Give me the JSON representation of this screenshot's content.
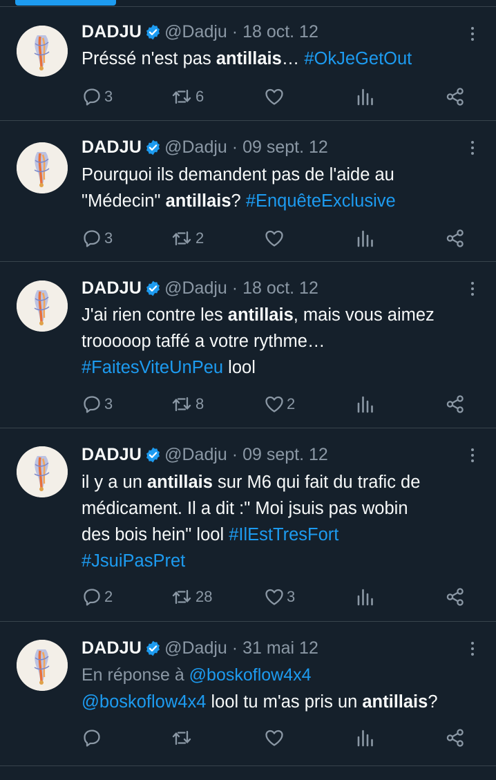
{
  "colors": {
    "background": "#15202b",
    "text": "#f7f9f9",
    "muted": "#8b98a5",
    "accent": "#1d9bf0",
    "divider": "#38444d"
  },
  "icons": {
    "verified": "verified-badge-icon",
    "more": "more-options-icon",
    "reply": "reply-icon",
    "retweet": "retweet-icon",
    "like": "like-icon",
    "views": "views-icon",
    "share": "share-icon"
  },
  "tweets": [
    {
      "name": "DADJU",
      "handle": "@Dadju",
      "separator": "·",
      "date": "18 oct. 12",
      "lines": [
        [
          {
            "t": "Préssé n'est pas "
          },
          {
            "t": "antillais",
            "s": "b"
          },
          {
            "t": "… "
          },
          {
            "t": "#OkJeGetOut",
            "s": "tag"
          }
        ]
      ],
      "replies": "3",
      "retweets": "6",
      "likes": ""
    },
    {
      "name": "DADJU",
      "handle": "@Dadju",
      "separator": "·",
      "date": "09 sept. 12",
      "lines": [
        [
          {
            "t": "Pourquoi ils demandent pas de l'aide au"
          }
        ],
        [
          {
            "t": "\"Médecin\" "
          },
          {
            "t": "antillais",
            "s": "b"
          },
          {
            "t": "? "
          },
          {
            "t": "#EnquêteExclusive",
            "s": "tag"
          }
        ]
      ],
      "replies": "3",
      "retweets": "2",
      "likes": ""
    },
    {
      "name": "DADJU",
      "handle": "@Dadju",
      "separator": "·",
      "date": "18 oct. 12",
      "lines": [
        [
          {
            "t": "J'ai rien contre les "
          },
          {
            "t": "antillais",
            "s": "b"
          },
          {
            "t": ", mais vous aimez"
          }
        ],
        [
          {
            "t": "trooooop taffé a votre rythme…"
          }
        ],
        [
          {
            "t": "#FaitesViteUnPeu",
            "s": "tag"
          },
          {
            "t": " lool"
          }
        ]
      ],
      "replies": "3",
      "retweets": "8",
      "likes": "2"
    },
    {
      "name": "DADJU",
      "handle": "@Dadju",
      "separator": "·",
      "date": "09 sept. 12",
      "lines": [
        [
          {
            "t": "il y a un "
          },
          {
            "t": "antillais",
            "s": "b"
          },
          {
            "t": " sur M6 qui fait du trafic de"
          }
        ],
        [
          {
            "t": "médicament. Il a dit :\" Moi jsuis pas wobin"
          }
        ],
        [
          {
            "t": "des bois hein\" lool "
          },
          {
            "t": "#IlEstTresFort",
            "s": "tag"
          }
        ],
        [
          {
            "t": "#JsuiPasPret",
            "s": "tag"
          }
        ]
      ],
      "replies": "2",
      "retweets": "28",
      "likes": "3"
    },
    {
      "name": "DADJU",
      "handle": "@Dadju",
      "separator": "·",
      "date": "31 mai 12",
      "reply_prefix": "En réponse à ",
      "reply_handle": "@boskoflow4x4",
      "lines": [
        [
          {
            "t": "@boskoflow4x4",
            "s": "tag"
          },
          {
            "t": " lool tu m'as pris un "
          },
          {
            "t": "antillais",
            "s": "b"
          },
          {
            "t": "?"
          }
        ]
      ],
      "replies": "",
      "retweets": "",
      "likes": ""
    }
  ]
}
